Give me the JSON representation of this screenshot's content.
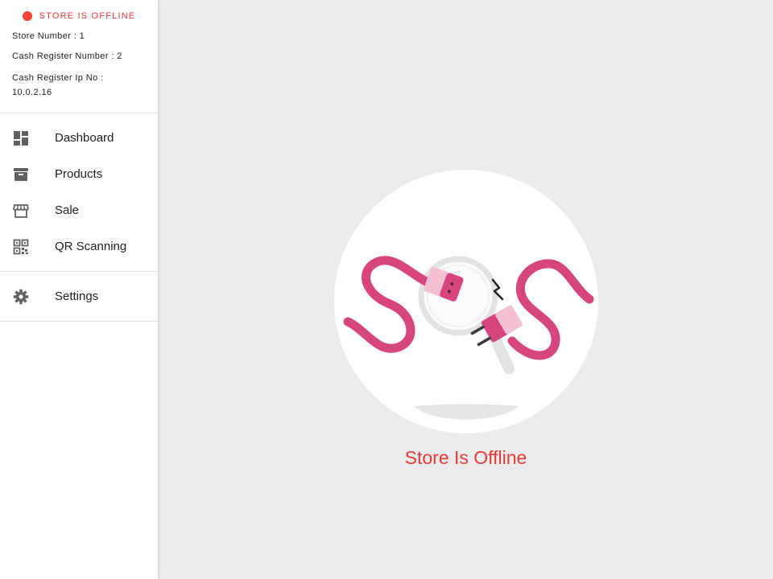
{
  "status": {
    "label": "STORE IS OFFLINE",
    "color": "#f44336"
  },
  "store_info": {
    "store_number": "Store Number : 1",
    "cash_register_number": "Cash Register Number : 2",
    "cash_register_ip": "Cash Register Ip No : 10.0.2.16"
  },
  "nav": {
    "items": [
      {
        "label": "Dashboard",
        "icon": "dashboard-icon"
      },
      {
        "label": "Products",
        "icon": "archive-box-icon"
      },
      {
        "label": "Sale",
        "icon": "storefront-icon"
      },
      {
        "label": "QR Scanning",
        "icon": "qr-code-icon"
      }
    ],
    "settings": {
      "label": "Settings",
      "icon": "gear-icon"
    }
  },
  "main": {
    "message": "Store Is Offline",
    "illustration": "unplugged-cable-illustration",
    "accent_color": "#e53935",
    "cable_color": "#d6467c"
  }
}
